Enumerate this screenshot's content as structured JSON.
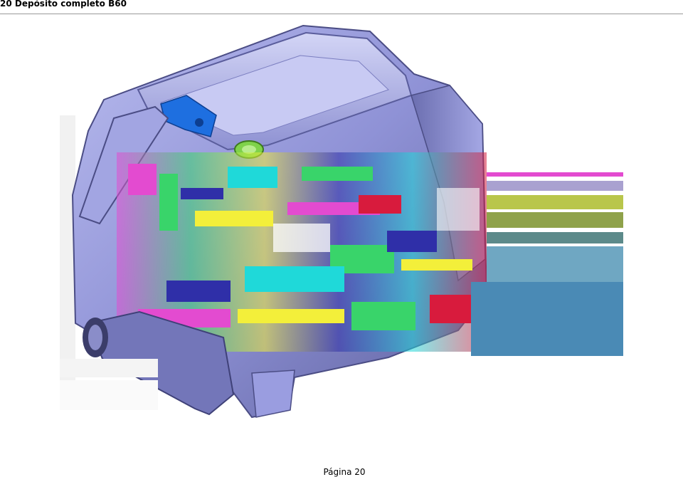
{
  "header": {
    "title": "20 Depósito completo B60"
  },
  "figure": {
    "subject": "tank-assembly-3d-rendering",
    "colors": {
      "body": "#8f92d6",
      "body_dark": "#5c5f9e",
      "body_light": "#c4c6f0",
      "accent_blue": "#1e6fe0",
      "accent_green": "#7fd24a",
      "artifact_blue": "#4a8ab5"
    }
  },
  "footer": {
    "page_label": "Página 20"
  }
}
